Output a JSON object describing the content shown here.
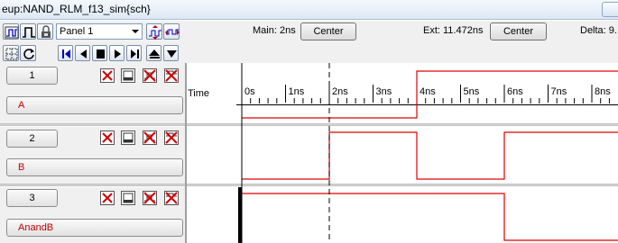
{
  "window": {
    "title": "eup:NAND_RLM_f13_sim{sch}"
  },
  "toolbar": {
    "panel_select": "Panel 1",
    "time_header": "Time",
    "main_label": "Main: 2ns",
    "main_center": "Center",
    "ext_label": "Ext: 11.472ns",
    "ext_center": "Center",
    "delta_label": "Delta: 9."
  },
  "ruler": {
    "ticks": [
      "0s",
      "1ns",
      "2ns",
      "3ns",
      "4ns",
      "5ns",
      "6ns",
      "7ns",
      "8ns"
    ]
  },
  "signals": [
    {
      "panel": "1",
      "name": "A"
    },
    {
      "panel": "2",
      "name": "B"
    },
    {
      "panel": "3",
      "name": "AnandB"
    }
  ],
  "colors": {
    "waveform": "#e00000",
    "cursor_main": "#000000",
    "cursor_ext": "#000000"
  },
  "chart_data": {
    "type": "line",
    "xlabel": "Time",
    "x_unit": "ns",
    "xlim": [
      -1.1,
      8.7
    ],
    "main_cursor": 0,
    "ext_cursor": 2,
    "series": [
      {
        "name": "A",
        "points": [
          [
            0,
            0
          ],
          [
            4,
            0
          ],
          [
            4,
            1
          ],
          [
            8.7,
            1
          ]
        ]
      },
      {
        "name": "B",
        "points": [
          [
            0,
            0
          ],
          [
            2,
            0
          ],
          [
            2,
            1
          ],
          [
            4,
            1
          ],
          [
            4,
            0
          ],
          [
            6,
            0
          ],
          [
            6,
            1
          ],
          [
            8.7,
            1
          ]
        ]
      },
      {
        "name": "AnandB",
        "points": [
          [
            0,
            1
          ],
          [
            6,
            1
          ],
          [
            6,
            0
          ],
          [
            8.7,
            0
          ]
        ]
      }
    ]
  }
}
